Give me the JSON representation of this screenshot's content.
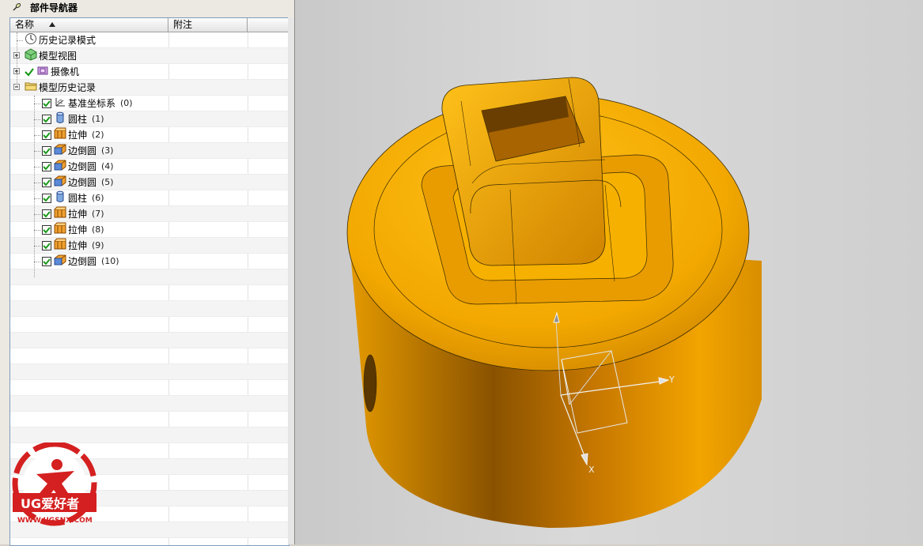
{
  "navigator": {
    "title": "部件导航器",
    "columns": [
      "名称",
      "附注"
    ]
  },
  "tree": [
    {
      "label": "历史记录模式",
      "index": "",
      "icon": "history-clock-icon"
    },
    {
      "label": "模型视图",
      "index": "",
      "icon": "model-view-icon"
    },
    {
      "label": "摄像机",
      "index": "",
      "icon": "camera-icon"
    },
    {
      "label": "模型历史记录",
      "index": "",
      "icon": "folder-icon"
    },
    {
      "label": "基准坐标系",
      "index": "(0)",
      "icon": "datum-csys-icon"
    },
    {
      "label": "圆柱",
      "index": "(1)",
      "icon": "cylinder-icon"
    },
    {
      "label": "拉伸",
      "index": "(2)",
      "icon": "extrude-icon"
    },
    {
      "label": "边倒圆",
      "index": "(3)",
      "icon": "edge-blend-icon"
    },
    {
      "label": "边倒圆",
      "index": "(4)",
      "icon": "edge-blend-icon"
    },
    {
      "label": "边倒圆",
      "index": "(5)",
      "icon": "edge-blend-icon"
    },
    {
      "label": "圆柱",
      "index": "(6)",
      "icon": "cylinder-icon"
    },
    {
      "label": "拉伸",
      "index": "(7)",
      "icon": "extrude-icon"
    },
    {
      "label": "拉伸",
      "index": "(8)",
      "icon": "extrude-icon"
    },
    {
      "label": "拉伸",
      "index": "(9)",
      "icon": "extrude-icon"
    },
    {
      "label": "边倒圆",
      "index": "(10)",
      "icon": "edge-blend-icon"
    }
  ],
  "viewport": {
    "axes": {
      "y": "Y",
      "x": "X"
    },
    "model_color": "#f2a800"
  },
  "watermark": {
    "brand": "UG爱好者",
    "url": "WWW.UGSNX.COM",
    "color": "#d42020"
  }
}
